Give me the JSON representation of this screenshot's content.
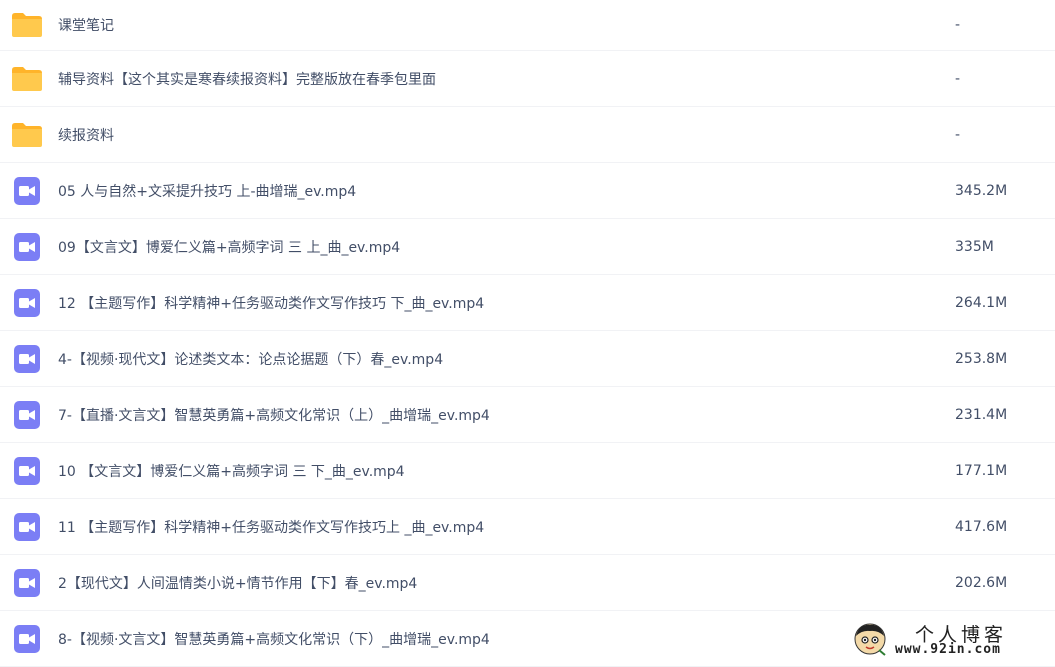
{
  "files": [
    {
      "type": "folder",
      "icon": "folder-icon",
      "name": "课堂笔记",
      "size": "-"
    },
    {
      "type": "folder",
      "icon": "folder-icon",
      "name": "辅导资料【这个其实是寒春续报资料】完整版放在春季包里面",
      "size": "-"
    },
    {
      "type": "folder",
      "icon": "folder-icon",
      "name": "续报资料",
      "size": "-"
    },
    {
      "type": "video",
      "icon": "video-file-icon",
      "name": "05 人与自然+文采提升技巧 上-曲增瑞_ev.mp4",
      "size": "345.2M"
    },
    {
      "type": "video",
      "icon": "video-file-icon",
      "name": "09【文言文】博爱仁义篇+高频字词 三 上_曲_ev.mp4",
      "size": "335M"
    },
    {
      "type": "video",
      "icon": "video-file-icon",
      "name": "12 【主题写作】科学精神+任务驱动类作文写作技巧 下_曲_ev.mp4",
      "size": "264.1M"
    },
    {
      "type": "video",
      "icon": "video-file-icon",
      "name": "4-【视频·现代文】论述类文本：论点论据题（下）春_ev.mp4",
      "size": "253.8M"
    },
    {
      "type": "video",
      "icon": "video-file-icon",
      "name": "7-【直播·文言文】智慧英勇篇+高频文化常识（上）_曲增瑞_ev.mp4",
      "size": "231.4M"
    },
    {
      "type": "video",
      "icon": "video-file-icon",
      "name": "10 【文言文】博爱仁义篇+高频字词 三 下_曲_ev.mp4",
      "size": "177.1M"
    },
    {
      "type": "video",
      "icon": "video-file-icon",
      "name": "11 【主题写作】科学精神+任务驱动类作文写作技巧上 _曲_ev.mp4",
      "size": "417.6M"
    },
    {
      "type": "video",
      "icon": "video-file-icon",
      "name": "2【现代文】人间温情类小说+情节作用【下】春_ev.mp4",
      "size": "202.6M"
    },
    {
      "type": "video",
      "icon": "video-file-icon",
      "name": "8-【视频·文言文】智慧英勇篇+高频文化常识（下）_曲增瑞_ev.mp4",
      "size": ""
    }
  ],
  "watermark": {
    "title": "个人博客",
    "url": "www.92in.com"
  },
  "colors": {
    "folder": "#ffc94d",
    "folder_tab": "#ffb42a",
    "video": "#7b7ef5",
    "text": "#424e67",
    "divider": "#f1f2f5"
  }
}
